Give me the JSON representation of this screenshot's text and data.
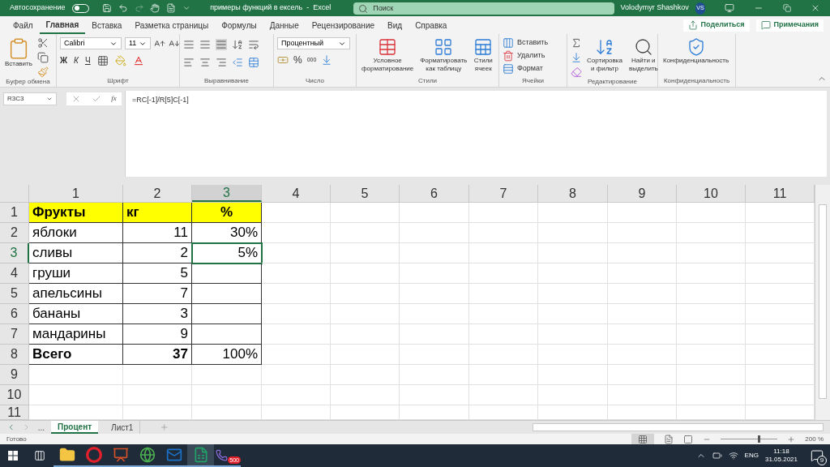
{
  "title_bar": {
    "autosave_label": "Автосохранение",
    "autosave_on": false,
    "document_title": "примеры функций в ексель  -  Excel",
    "search_placeholder": "Поиск",
    "user_name": "Volodymyr Shashkov",
    "user_initials": "VS"
  },
  "ribbon_tabs": [
    {
      "label": "Файл",
      "selected": false
    },
    {
      "label": "Главная",
      "selected": true
    },
    {
      "label": "Вставка",
      "selected": false
    },
    {
      "label": "Разметка страницы",
      "selected": false
    },
    {
      "label": "Формулы",
      "selected": false
    },
    {
      "label": "Данные",
      "selected": false
    },
    {
      "label": "Рецензирование",
      "selected": false
    },
    {
      "label": "Вид",
      "selected": false
    },
    {
      "label": "Справка",
      "selected": false
    }
  ],
  "share_button": "Поделиться",
  "comments_button": "Примечания",
  "ribbon": {
    "clipboard": {
      "paste": "Вставить",
      "label": "Буфер обмена"
    },
    "font": {
      "name": "Calibri",
      "size": "11",
      "bold": "Ж",
      "italic": "К",
      "underline": "Ч",
      "label": "Шрифт"
    },
    "alignment": {
      "label": "Выравнивание"
    },
    "number": {
      "format": "Процентный",
      "percent": "%",
      "thousands": "000",
      "label": "Число"
    },
    "styles": {
      "buttons": [
        "Условное\nформатирование",
        "Форматировать\nкак таблицу",
        "Стили\nячеек"
      ],
      "label": "Стили"
    },
    "cells": {
      "buttons": [
        "Вставить",
        "Удалить",
        "Формат"
      ],
      "label": "Ячейки"
    },
    "editing": {
      "buttons": [
        "Сортировка\nи фильтр",
        "Найти и\nвыделить"
      ],
      "label": "Редактирование"
    },
    "sensitivity": {
      "button": "Конфиденциальность",
      "label": "Конфиденциальность"
    }
  },
  "formula_bar": {
    "name_box": "R3C3",
    "function_button": "fx",
    "formula": "=RC[-1]/R[5]C[-1]"
  },
  "sheet": {
    "columns": [
      {
        "label": "1",
        "selected": false
      },
      {
        "label": "2",
        "selected": false
      },
      {
        "label": "3",
        "selected": true
      },
      {
        "label": "4",
        "selected": false
      },
      {
        "label": "5",
        "selected": false
      },
      {
        "label": "6",
        "selected": false
      },
      {
        "label": "7",
        "selected": false
      },
      {
        "label": "8",
        "selected": false
      },
      {
        "label": "9",
        "selected": false
      },
      {
        "label": "10",
        "selected": false
      },
      {
        "label": "11",
        "selected": false
      }
    ],
    "row_headers": [
      {
        "label": "1",
        "selected": false
      },
      {
        "label": "2",
        "selected": false
      },
      {
        "label": "3",
        "selected": true
      },
      {
        "label": "4",
        "selected": false
      },
      {
        "label": "5",
        "selected": false
      },
      {
        "label": "6",
        "selected": false
      },
      {
        "label": "7",
        "selected": false
      },
      {
        "label": "8",
        "selected": false
      },
      {
        "label": "9",
        "selected": false
      },
      {
        "label": "10",
        "selected": false
      },
      {
        "label": "11",
        "selected": false
      }
    ],
    "rows": [
      {
        "kind": "header",
        "cells": [
          "Фрукты",
          "кг",
          "%"
        ]
      },
      {
        "kind": "data",
        "cells": [
          "яблоки",
          "11",
          "30%"
        ]
      },
      {
        "kind": "data",
        "cells": [
          "сливы",
          "2",
          "5%"
        ]
      },
      {
        "kind": "data",
        "cells": [
          "груши",
          "5",
          ""
        ]
      },
      {
        "kind": "data",
        "cells": [
          "апельсины",
          "7",
          ""
        ]
      },
      {
        "kind": "data",
        "cells": [
          "бананы",
          "3",
          ""
        ]
      },
      {
        "kind": "data",
        "cells": [
          "мандарины",
          "9",
          ""
        ]
      },
      {
        "kind": "total",
        "cells": [
          "Всего",
          "37",
          "100%"
        ]
      }
    ]
  },
  "sheet_tabs": {
    "more": "...",
    "tabs": [
      {
        "label": "Процент",
        "selected": true
      },
      {
        "label": "Лист1",
        "selected": false
      }
    ]
  },
  "status_bar": {
    "status": "Готово",
    "zoom": "200 %",
    "zoom_slider": {
      "level": 0.65
    }
  },
  "taskbar": {
    "apps": [
      {
        "kind": "folder",
        "active": false
      },
      {
        "kind": "opera",
        "active": false
      },
      {
        "kind": "powerpoint",
        "active": false
      },
      {
        "kind": "chrome",
        "active": false
      },
      {
        "kind": "outlook",
        "active": false
      },
      {
        "kind": "excel",
        "active": true
      },
      {
        "kind": "viber",
        "active": false,
        "badge": "500"
      }
    ],
    "language": "ENG",
    "time": "11:18",
    "date": "31.05.2021",
    "notifications": "9"
  }
}
